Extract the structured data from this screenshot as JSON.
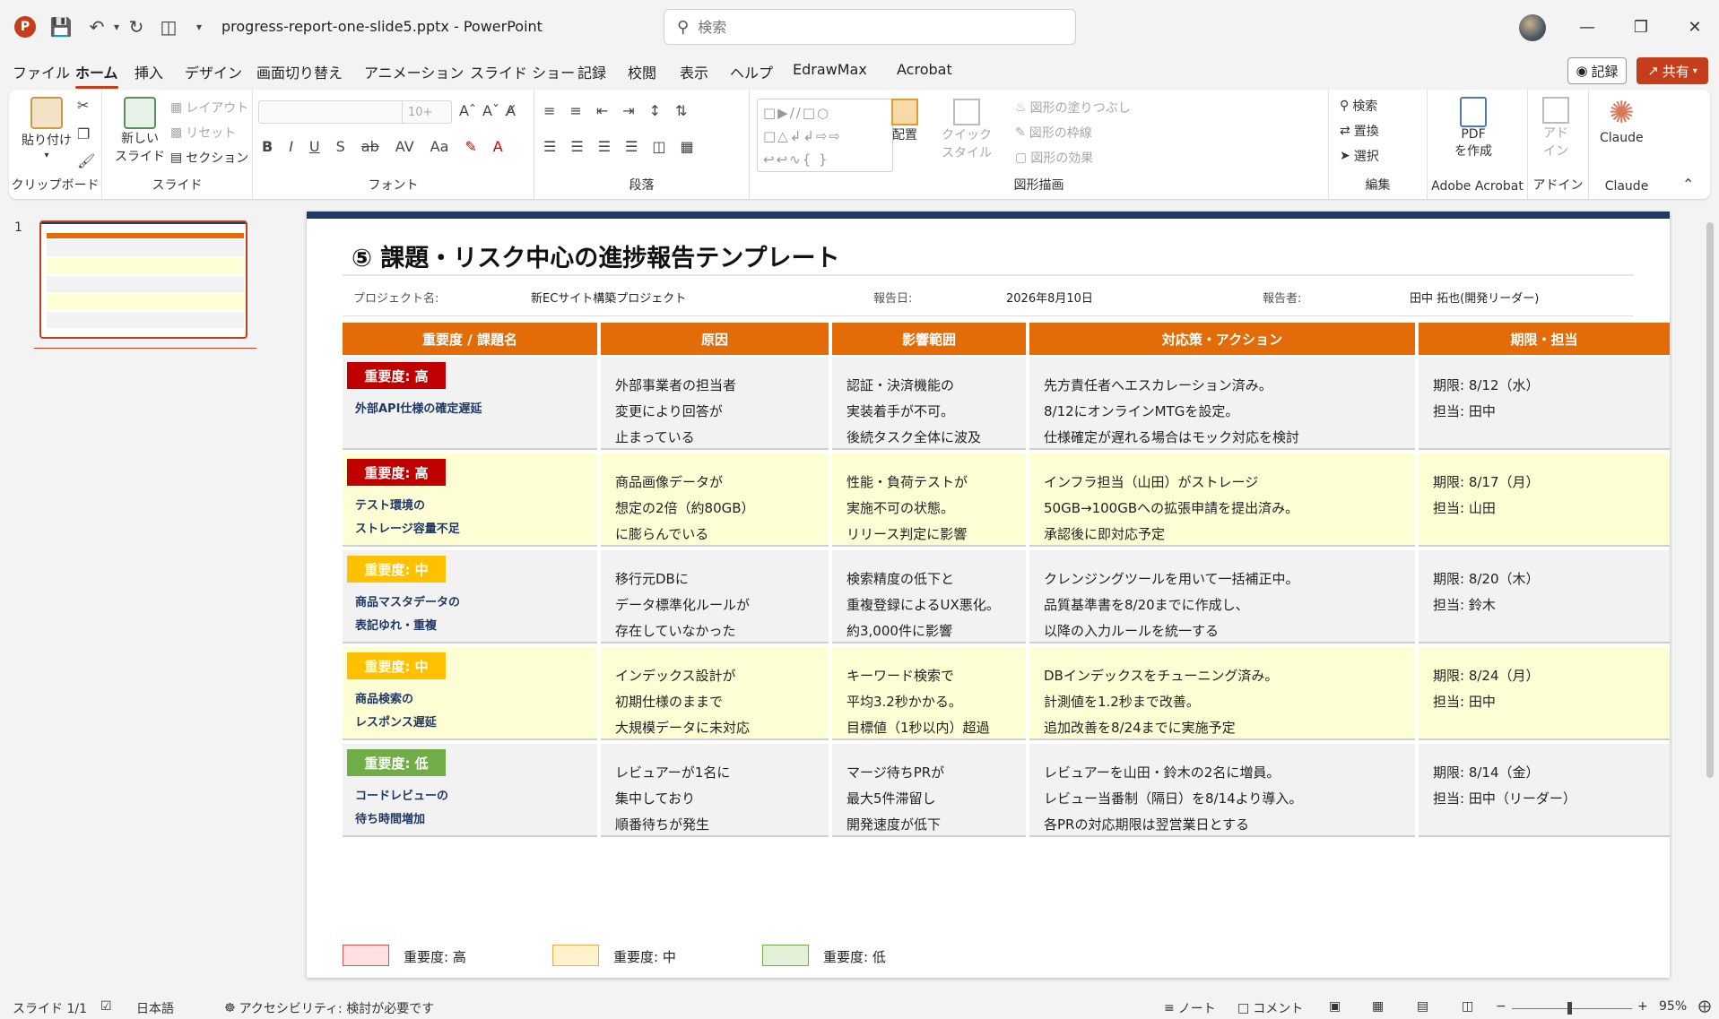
{
  "window": {
    "doc_title": "progress-report-one-slide5.pptx",
    "separator": "-",
    "app_name": "PowerPoint",
    "search_placeholder": "検索"
  },
  "menu": {
    "tabs": [
      "ファイル",
      "ホーム",
      "挿入",
      "デザイン",
      "画面切り替え",
      "アニメーション",
      "スライド ショー",
      "記録",
      "校閲",
      "表示",
      "ヘルプ",
      "EdrawMax",
      "Acrobat"
    ],
    "active_tab": "ホーム",
    "record_label": "記録",
    "share_label": "共有"
  },
  "ribbon": {
    "clipboard": {
      "paste": "貼り付け",
      "label": "クリップボード"
    },
    "slides": {
      "new_slide_1": "新しい",
      "new_slide_2": "スライド",
      "layout": "レイアウト",
      "reset": "リセット",
      "section": "セクション",
      "label": "スライド"
    },
    "font": {
      "size": "10+",
      "label": "フォント"
    },
    "paragraph": {
      "label": "段落"
    },
    "drawing": {
      "arrange": "配置",
      "quick_style_1": "クイック",
      "quick_style_2": "スタイル",
      "fill": "図形の塗りつぶし",
      "outline": "図形の枠線",
      "effect": "図形の効果",
      "label": "図形描画"
    },
    "editing": {
      "find": "検索",
      "replace": "置換",
      "select": "選択",
      "label": "編集"
    },
    "acrobat": {
      "pdf_1": "PDF",
      "pdf_2": "を作成",
      "label": "Adobe Acrobat"
    },
    "addin": {
      "addin_1": "アド",
      "addin_2": "イン",
      "label": "アドイン"
    },
    "claude": {
      "name": "Claude",
      "label": "Claude"
    }
  },
  "thumbnail": {
    "number": "1"
  },
  "slide": {
    "title": "⑤ 課題・リスク中心の進捗報告テンプレート",
    "meta": {
      "project_label": "プロジェクト名:",
      "project_value": "新ECサイト構築プロジェクト",
      "date_label": "報告日:",
      "date_value": "2026年8月10日",
      "reporter_label": "報告者:",
      "reporter_value": "田中 拓也(開発リーダー)"
    },
    "headers": [
      "重要度 / 課題名",
      "原因",
      "影響範囲",
      "対応策・アクション",
      "期限・担当"
    ],
    "rows": [
      {
        "severity": "重要度: 高",
        "issue": "外部API仕様の確定遅延",
        "cause": "外部事業者の担当者\n変更により回答が\n止まっている",
        "impact": "認証・決済機能の\n実装着手が不可。\n後続タスク全体に波及",
        "action": "先方責任者へエスカレーション済み。\n8/12にオンラインMTGを設定。\n仕様確定が遅れる場合はモック対応を検討",
        "deadline": "期限: 8/12（水）\n担当: 田中"
      },
      {
        "severity": "重要度: 高",
        "issue": "テスト環境の\nストレージ容量不足",
        "cause": "商品画像データが\n想定の2倍（約80GB）\nに膨らんでいる",
        "impact": "性能・負荷テストが\n実施不可の状態。\nリリース判定に影響",
        "action": "インフラ担当（山田）がストレージ\n50GB→100GBへの拡張申請を提出済み。\n承認後に即対応予定",
        "deadline": "期限: 8/17（月）\n担当: 山田"
      },
      {
        "severity": "重要度: 中",
        "issue": "商品マスタデータの\n表記ゆれ・重複",
        "cause": "移行元DBに\nデータ標準化ルールが\n存在していなかった",
        "impact": "検索精度の低下と\n重複登録によるUX悪化。\n約3,000件に影響",
        "action": "クレンジングツールを用いて一括補正中。\n品質基準書を8/20までに作成し、\n以降の入力ルールを統一する",
        "deadline": "期限: 8/20（木）\n担当: 鈴木"
      },
      {
        "severity": "重要度: 中",
        "issue": "商品検索の\nレスポンス遅延",
        "cause": "インデックス設計が\n初期仕様のままで\n大規模データに未対応",
        "impact": "キーワード検索で\n平均3.2秒かかる。\n目標値（1秒以内）超過",
        "action": "DBインデックスをチューニング済み。\n計測値を1.2秒まで改善。\n追加改善を8/24までに実施予定",
        "deadline": "期限: 8/24（月）\n担当: 田中"
      },
      {
        "severity": "重要度: 低",
        "issue": "コードレビューの\n待ち時間増加",
        "cause": "レビュアーが1名に\n集中しており\n順番待ちが発生",
        "impact": "マージ待ちPRが\n最大5件滞留し\n開発速度が低下",
        "action": "レビュアーを山田・鈴木の2名に増員。\nレビュー当番制（隔日）を8/14より導入。\n各PRの対応期限は翌営業日とする",
        "deadline": "期限: 8/14（金）\n担当: 田中（リーダー）"
      }
    ],
    "legend": [
      "重要度: 高",
      "重要度: 中",
      "重要度: 低"
    ]
  },
  "colors": {
    "accent": "#c43e1c",
    "header_orange": "#e36c09",
    "navy": "#1f3864",
    "severity_high": "#c00000",
    "severity_mid": "#ffc000",
    "severity_low": "#70ad47",
    "legend_high": "#ffe0e0",
    "legend_mid": "#fff2cc",
    "legend_low": "#e2f0d9"
  },
  "statusbar": {
    "slide_count": "スライド 1/1",
    "language": "日本語",
    "accessibility": "アクセシビリティ: 検討が必要です",
    "notes": "ノート",
    "comments": "コメント",
    "zoom_percent": "95%"
  }
}
